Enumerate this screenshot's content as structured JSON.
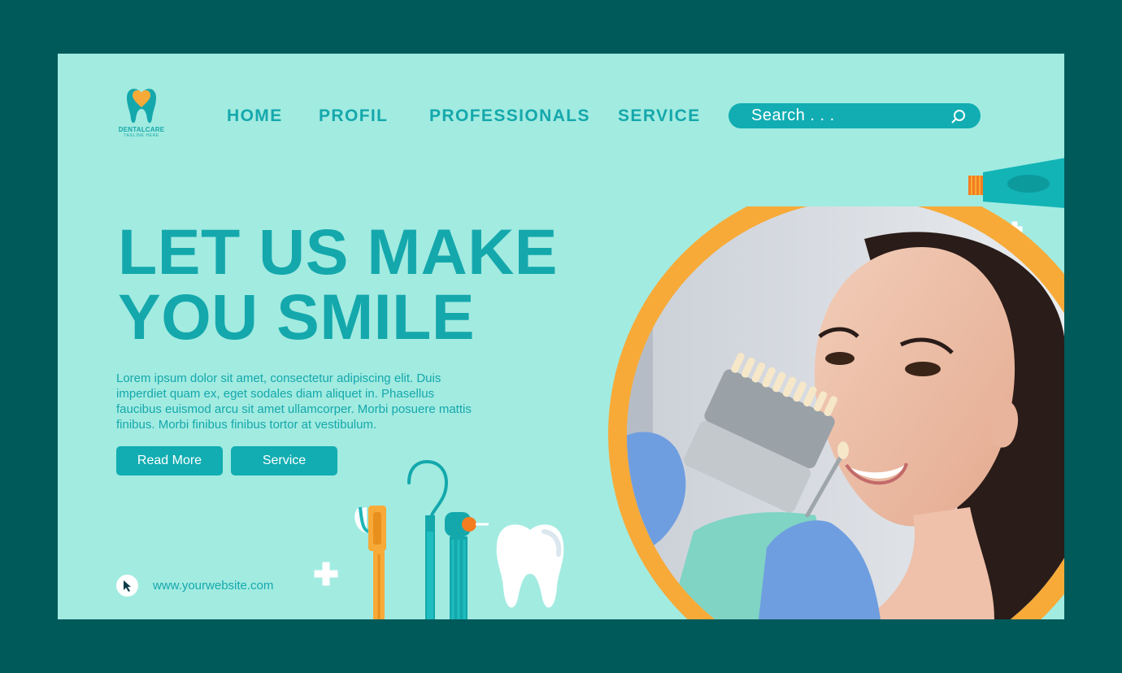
{
  "brand": {
    "name": "DENTALCARE",
    "tagline": "TAGLINE HERE"
  },
  "nav": {
    "items": [
      {
        "label": "HOME"
      },
      {
        "label": "PROFIL"
      },
      {
        "label": "PROFESSIONALS"
      },
      {
        "label": "SERVICE"
      }
    ]
  },
  "search": {
    "placeholder": "Search . . ."
  },
  "hero": {
    "title_line1": "LET US MAKE",
    "title_line2": "YOU SMILE",
    "body": "Lorem ipsum dolor sit amet, consectetur adipiscing elit. Duis imperdiet quam ex, eget sodales diam aliquet in. Phasellus faucibus euismod arcu sit amet ullamcorper. Morbi posuere mattis finibus. Morbi finibus finibus tortor at vestibulum.",
    "read_more_label": "Read More",
    "service_label": "Service"
  },
  "footer": {
    "website": "www.yourwebsite.com"
  },
  "colors": {
    "background": "#005a5a",
    "panel": "#a2ebe1",
    "accent": "#14a8ac",
    "orange": "#f7aa38"
  },
  "icons": [
    "tooth-logo-icon",
    "search-icon",
    "cursor-icon",
    "plus-icon",
    "toothpaste-icon",
    "toothbrush-icon",
    "dental-probe-icon",
    "dental-drill-icon",
    "tooth-icon"
  ]
}
